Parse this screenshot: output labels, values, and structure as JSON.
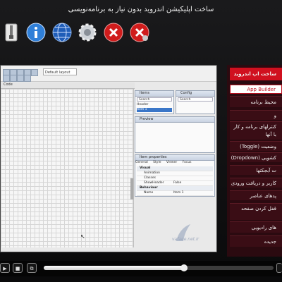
{
  "window": {
    "title": "ساخت اپلیکیشن اندروید بدون نیاز به برنامه‌نویسی"
  },
  "toolbar": {
    "icons": [
      "file-zipper-icon",
      "info-icon",
      "globe-icon",
      "gear-icon",
      "close-icon",
      "close-settings-icon"
    ]
  },
  "editor": {
    "theme_select": "Default layout",
    "tab_label": "Code",
    "objects_title": "Items",
    "config_title": "Config",
    "search_placeholder": "Search",
    "objects": [
      "Header",
      "Item 1"
    ],
    "preview_title": "Preview",
    "properties_title": "Item properties",
    "property_tabs": [
      "General",
      "Style",
      "Viewer",
      "Focus"
    ],
    "sections": [
      {
        "name": "Visual",
        "rows": [
          {
            "k": "Animation",
            "v": ""
          },
          {
            "k": "Classes",
            "v": ""
          },
          {
            "k": "ShowHeader",
            "v": "False"
          }
        ]
      },
      {
        "name": "Behaviour",
        "rows": [
          {
            "k": "Name",
            "v": "Item 1"
          }
        ]
      }
    ],
    "watermark": "vafaee.net.ir"
  },
  "menu": {
    "items": [
      {
        "label": "ساخت اپ اندروید",
        "style": "header"
      },
      {
        "label": "App Builder",
        "style": "sub"
      },
      {
        "label": "محیط برنامه",
        "style": "normal"
      },
      {
        "label": "و",
        "style": "normal"
      },
      {
        "label": "کنترلهای برنامه و کار با آنها",
        "style": "normal"
      },
      {
        "label": "وضعیت (Toggle)",
        "style": "normal"
      },
      {
        "label": "کشویی (Dropdown)",
        "style": "normal"
      },
      {
        "label": "ت آبجکتها",
        "style": "normal"
      },
      {
        "label": "کاربر و دریافت ورودی",
        "style": "normal"
      },
      {
        "label": "پدهای عناصر",
        "style": "normal"
      },
      {
        "label": "قفل کردن صفحه",
        "style": "normal"
      },
      {
        "label": "های رادیویی",
        "style": "normal"
      },
      {
        "label": "جدیده",
        "style": "normal"
      }
    ]
  },
  "player": {
    "buttons": [
      "play-icon",
      "stop-icon",
      "fullscreen-icon",
      "window-icon"
    ],
    "progress": 0.61
  },
  "colors": {
    "accent": "#d0101f",
    "menu_bg": "#3a0d15"
  }
}
